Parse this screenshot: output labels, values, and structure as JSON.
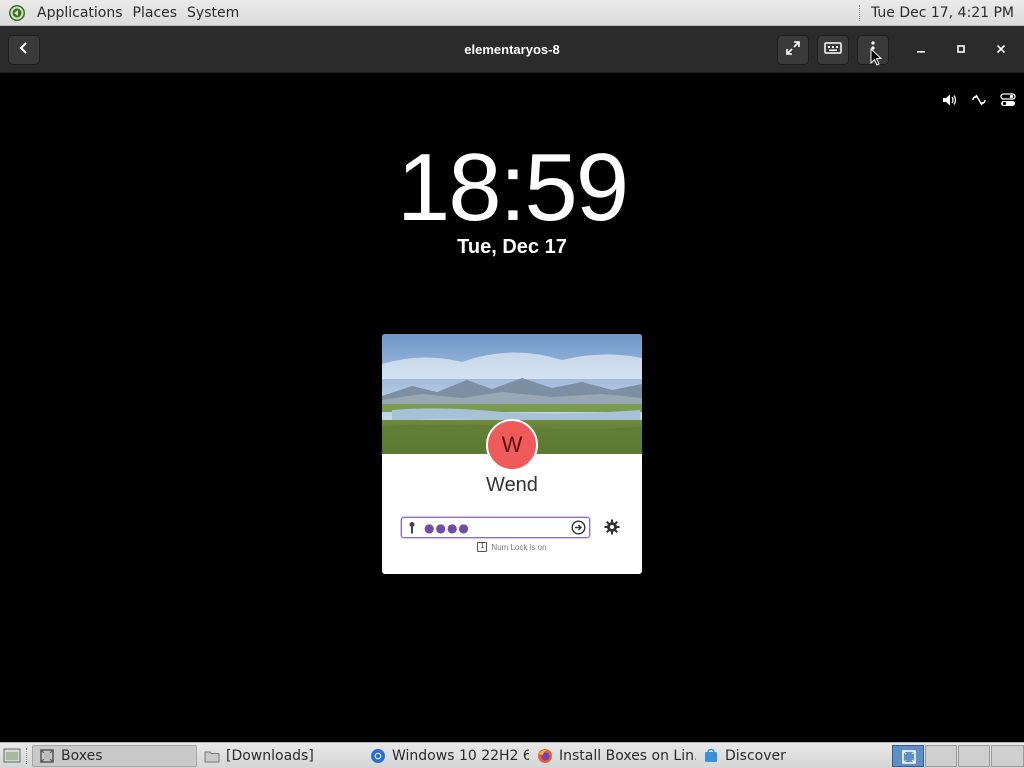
{
  "top_panel": {
    "menus": [
      "Applications",
      "Places",
      "System"
    ],
    "clock": "Tue Dec 17,  4:21 PM"
  },
  "header": {
    "title": "elementaryos-8",
    "icons": [
      "back-arrow-icon",
      "fullscreen-icon",
      "keyboard-icon",
      "kebab-menu-icon",
      "minimize-icon",
      "maximize-icon",
      "close-icon"
    ]
  },
  "vm": {
    "time": "18:59",
    "date": "Tue, Dec 17",
    "status_icons": [
      "volume-icon",
      "network-disconnected-icon",
      "session-toggle-icon"
    ],
    "login": {
      "avatar_initial": "W",
      "user_name": "Wend",
      "password_mask": "●●●●",
      "numlock_text": "Num Lock is on"
    }
  },
  "taskbar": {
    "items": [
      {
        "label": "Boxes",
        "icon": "boxes-icon",
        "active": true
      },
      {
        "label": "[Downloads]",
        "icon": "folder-icon",
        "active": false
      },
      {
        "label": "Windows 10 22H2 6...",
        "icon": "chrome-icon",
        "active": false
      },
      {
        "label": "Install Boxes on Lin...",
        "icon": "firefox-icon",
        "active": false
      },
      {
        "label": "Discover",
        "icon": "discover-icon",
        "active": false
      }
    ]
  },
  "colors": {
    "avatar": "#ef5b5b",
    "field_border": "#8c6bc0",
    "workspace_active": "#5f8fc4"
  }
}
